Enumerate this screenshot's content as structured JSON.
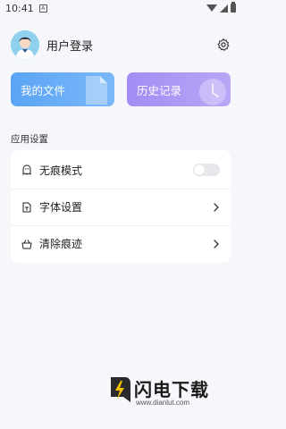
{
  "status_bar": {
    "time": "10:41",
    "notification_letter": "A"
  },
  "profile": {
    "name": "用户登录"
  },
  "cards": {
    "files": {
      "label": "我的文件"
    },
    "history": {
      "label": "历史记录"
    }
  },
  "settings": {
    "section_title": "应用设置",
    "rows": [
      {
        "label": "无痕模式",
        "icon": "ghost-icon",
        "control": "toggle",
        "enabled": false
      },
      {
        "label": "字体设置",
        "icon": "font-file-icon",
        "control": "chevron"
      },
      {
        "label": "清除痕迹",
        "icon": "basket-icon",
        "control": "chevron"
      }
    ]
  },
  "watermark": {
    "title": "闪电下载",
    "url": "www.dianlut.com"
  },
  "colors": {
    "files_card": "#5aa4f6",
    "history_card": "#a38cf3",
    "background": "#f6f7fb"
  }
}
